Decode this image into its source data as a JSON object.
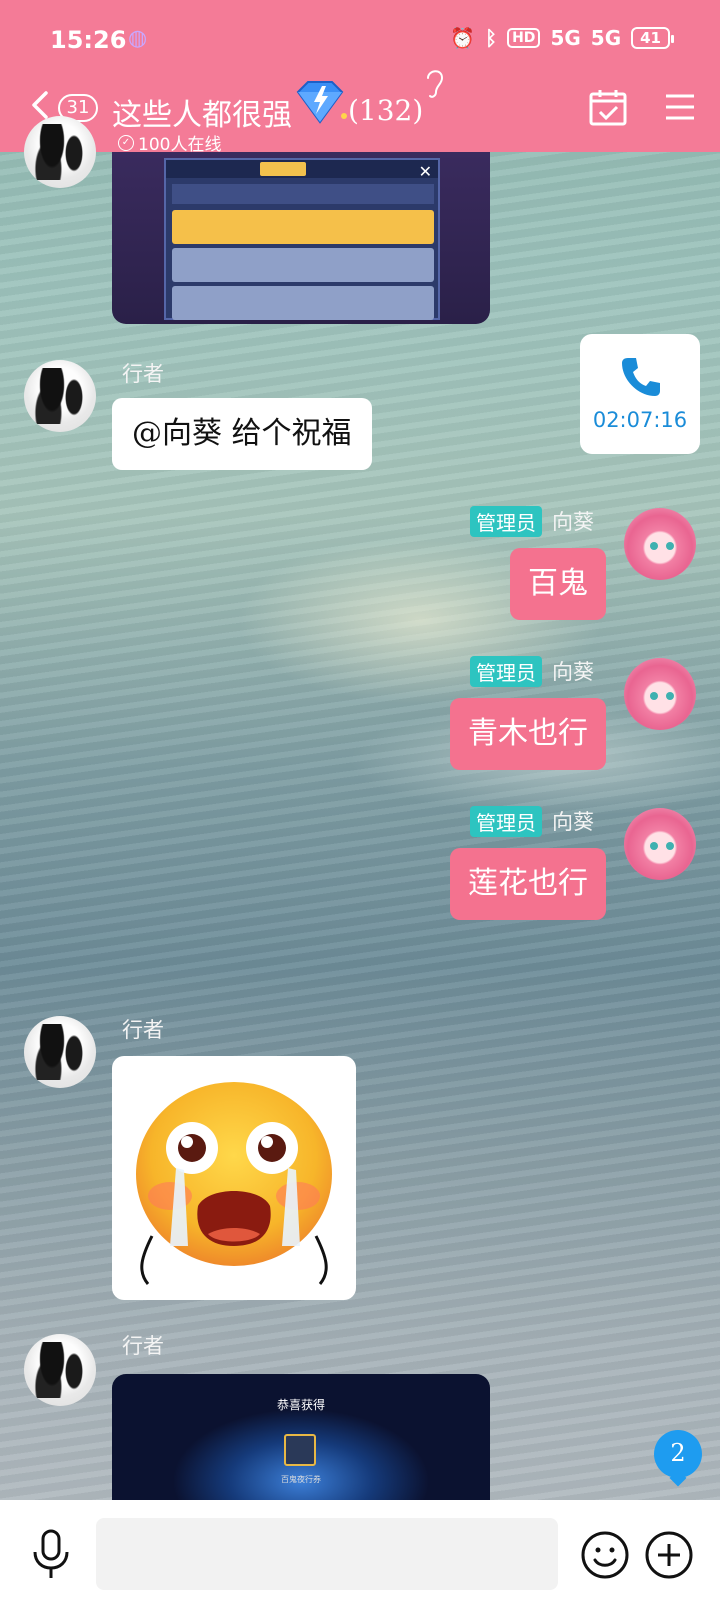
{
  "status_bar": {
    "time": "15:26",
    "hd_label": "HD",
    "network_1": "5G",
    "network_2": "5G",
    "battery": "41"
  },
  "header": {
    "unread_count": "31",
    "group_title": "这些人都很强",
    "member_count": "(132)",
    "online_text": "100人在线"
  },
  "messages": [
    {
      "sender": "行者",
      "text": "@向葵 给个祝福"
    },
    {
      "admin_tag": "管理员",
      "sender": "向葵",
      "text": "百鬼"
    },
    {
      "admin_tag": "管理员",
      "sender": "向葵",
      "text": "青木也行"
    },
    {
      "admin_tag": "管理员",
      "sender": "向葵",
      "text": "莲花也行"
    },
    {
      "sender": "行者"
    },
    {
      "sender": "行者"
    }
  ],
  "call_card": {
    "duration": "02:07:16"
  },
  "game_shot_2": {
    "title": "恭喜获得",
    "item_label": "百鬼夜行券"
  },
  "new_message_count": "2",
  "input_bar": {
    "placeholder": ""
  },
  "colors": {
    "header_pink": "#f47b97",
    "bubble_pink": "#f4728f",
    "admin_teal": "#2dc4c0",
    "call_blue": "#1a8cd8",
    "badge_blue": "#1e9cf0"
  }
}
